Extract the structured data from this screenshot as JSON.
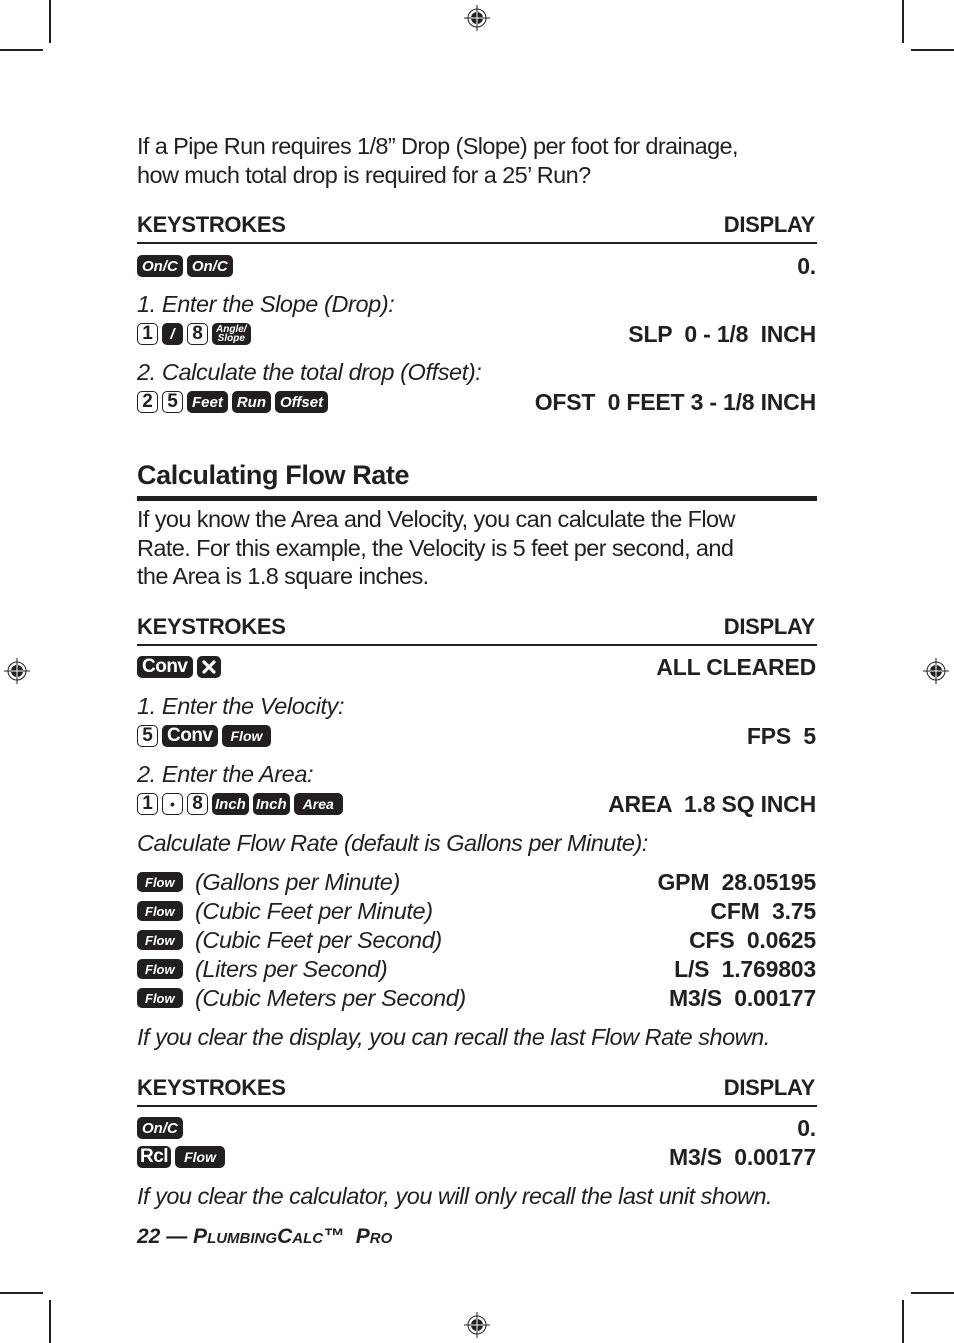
{
  "intro": {
    "line1": "If a Pipe Run requires 1/8” Drop (Slope) per foot for drainage,",
    "line2": "how much total drop is required for a 25’ Run?"
  },
  "table1": {
    "header": {
      "keystrokes": "KEYSTROKES",
      "display": "DISPLAY"
    },
    "rows": [
      {
        "keys": [
          "On/C",
          "On/C"
        ],
        "display": "0."
      },
      {
        "step": "1. Enter the Slope (Drop):",
        "keys": [
          "1",
          "/",
          "8",
          "Angle/Slope"
        ],
        "display": "SLP  0 - 1/8  INCH"
      },
      {
        "step": "2. Calculate the total drop (Offset):",
        "keys": [
          "2",
          "5",
          "Feet",
          "Run",
          "Offset"
        ],
        "display": "OFST  0 FEET 3 - 1/8 INCH"
      }
    ]
  },
  "section": {
    "title": "Calculating Flow Rate",
    "body": [
      "If you know the Area and Velocity, you can calculate the Flow",
      "Rate. For this example, the Velocity is 5 feet per second, and",
      "the Area is 1.8 square inches."
    ]
  },
  "table2": {
    "header": {
      "keystrokes": "KEYSTROKES",
      "display": "DISPLAY"
    },
    "rows": [
      {
        "keys": [
          "Conv",
          "x"
        ],
        "display": "ALL CLEARED"
      },
      {
        "step": "1. Enter the Velocity:",
        "keys": [
          "5",
          "Conv",
          "Flow"
        ],
        "display": "FPS  5"
      },
      {
        "step": "2. Enter the Area:",
        "keys": [
          "1",
          "•",
          "8",
          "Inch",
          "Inch",
          "Area"
        ],
        "display": "AREA  1.8 SQ INCH"
      }
    ],
    "calc_note": "Calculate Flow Rate (default is Gallons per Minute):",
    "flow_rows": [
      {
        "key": "Flow",
        "label": "(Gallons per Minute)",
        "display": "GPM  28.05195"
      },
      {
        "key": "Flow",
        "label": "(Cubic Feet per Minute)",
        "display": "CFM  3.75"
      },
      {
        "key": "Flow",
        "label": "(Cubic Feet per Second)",
        "display": "CFS  0.0625"
      },
      {
        "key": "Flow",
        "label": "(Liters per Second)",
        "display": "L/S  1.769803"
      },
      {
        "key": "Flow",
        "label": "(Cubic Meters per Second)",
        "display": "M3/S  0.00177"
      }
    ],
    "recall_note": "If you clear the display, you can recall the last Flow Rate shown."
  },
  "table3": {
    "header": {
      "keystrokes": "KEYSTROKES",
      "display": "DISPLAY"
    },
    "rows": [
      {
        "keys": [
          "On/C"
        ],
        "display": "0."
      },
      {
        "keys": [
          "Rcl",
          "Flow"
        ],
        "display": "M3/S  0.00177"
      }
    ],
    "clear_note": "If you clear the calculator, you will only recall the last unit shown."
  },
  "footer": {
    "page_number": "22",
    "dash": "—",
    "product_p": "P",
    "product_lumbing": "LUMBING",
    "product_c": "C",
    "product_alc": "ALC",
    "tm": "™",
    "pro_p": "P",
    "pro_ro": "RO"
  }
}
